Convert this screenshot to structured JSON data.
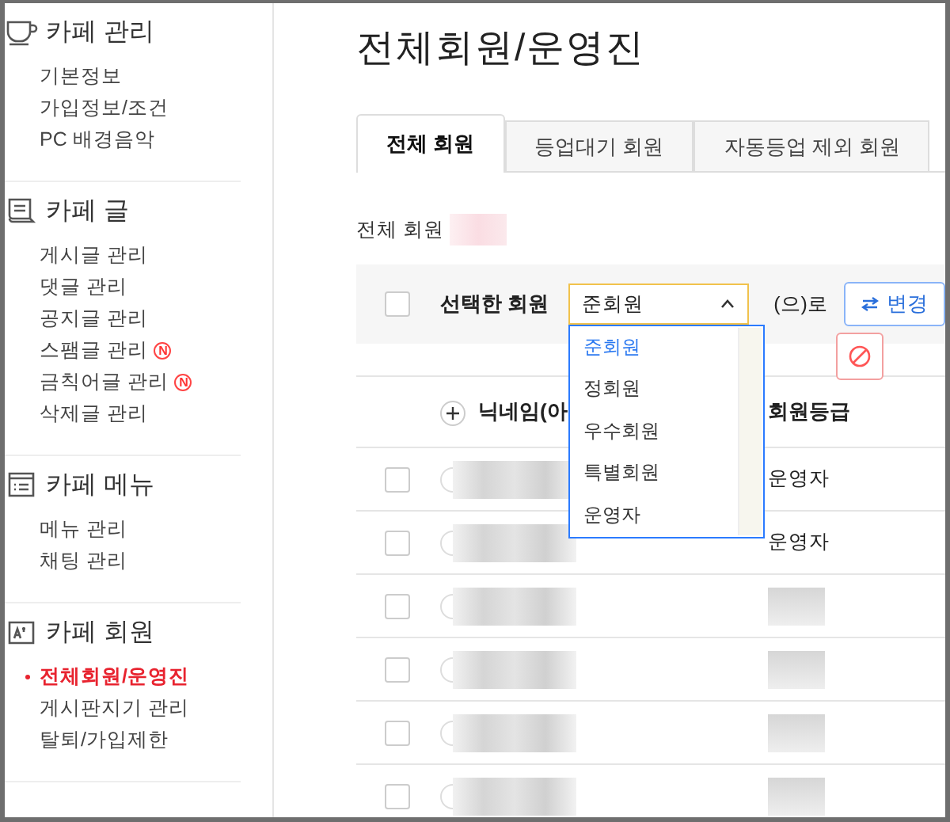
{
  "sidebar": {
    "sections": [
      {
        "title": "카페 관리",
        "items": [
          {
            "label": "기본정보",
            "selected": false
          },
          {
            "label": "가입정보/조건",
            "selected": false
          },
          {
            "label": "PC 배경음악",
            "selected": false
          }
        ]
      },
      {
        "title": "카페 글",
        "items": [
          {
            "label": "게시글 관리",
            "selected": false
          },
          {
            "label": "댓글 관리",
            "selected": false
          },
          {
            "label": "공지글 관리",
            "selected": false
          },
          {
            "label": "스팸글 관리",
            "selected": false,
            "badge": "N"
          },
          {
            "label": "금칙어글 관리",
            "selected": false,
            "badge": "N"
          },
          {
            "label": "삭제글 관리",
            "selected": false
          }
        ]
      },
      {
        "title": "카페 메뉴",
        "items": [
          {
            "label": "메뉴 관리",
            "selected": false
          },
          {
            "label": "채팅 관리",
            "selected": false
          }
        ]
      },
      {
        "title": "카페 회원",
        "items": [
          {
            "label": "전체회원/운영진",
            "selected": true
          },
          {
            "label": "게시판지기 관리",
            "selected": false
          },
          {
            "label": "탈퇴/가입제한",
            "selected": false
          }
        ]
      }
    ]
  },
  "page_title": "전체회원/운영진",
  "tabs": [
    {
      "label": "전체 회원",
      "selected": true
    },
    {
      "label": "등업대기 회원",
      "selected": false
    },
    {
      "label": "자동등업 제외 회원",
      "selected": false
    }
  ],
  "member_count_label": "전체 회원",
  "action_bar": {
    "checked": false,
    "label": "선택한 회원",
    "grade_select": {
      "value": "준회원",
      "expanded": true,
      "options": [
        {
          "label": "준회원",
          "selected": true
        },
        {
          "label": "정회원",
          "selected": false
        },
        {
          "label": "우수회원",
          "selected": false
        },
        {
          "label": "특별회원",
          "selected": false
        },
        {
          "label": "운영자",
          "selected": false
        }
      ]
    },
    "suffix": "(으)로",
    "change_button": "변경"
  },
  "table": {
    "columns": [
      "닉네임(아",
      "회원등급"
    ],
    "rows": [
      {
        "checked": false,
        "grade": "운영자"
      },
      {
        "checked": false,
        "grade": "운영자"
      },
      {
        "checked": false
      },
      {
        "checked": false
      },
      {
        "checked": false
      },
      {
        "checked": false
      }
    ]
  }
}
